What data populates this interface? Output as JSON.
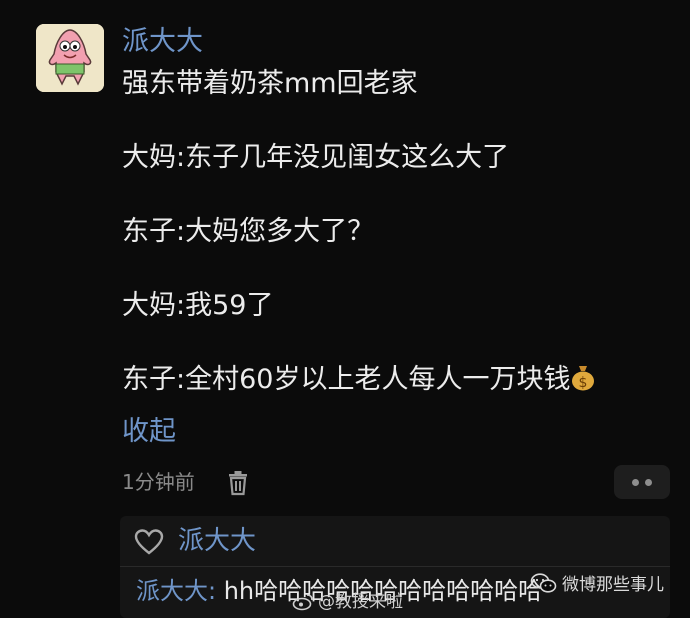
{
  "comment": {
    "author": "派大大",
    "lines": [
      "强东带着奶茶mm回老家",
      "大妈:东子几年没见闺女这么大了",
      "东子:大妈您多大了？",
      "大妈:我59了",
      "东子:全村60岁以上老人每人一万块钱"
    ],
    "collapse_label": "收起",
    "time": "1分钟前"
  },
  "likes_panel": {
    "liker_name": "派大大",
    "reply_author": "派大大:",
    "reply_text": " hh哈哈哈哈哈哈哈哈哈哈哈哈"
  },
  "watermarks": {
    "left": "@教授来啦",
    "right": "微博那些事儿"
  },
  "colors": {
    "background": "#0b0b0b",
    "username_blue": "#6f95c9",
    "text": "#ececec",
    "muted": "#8a8a8a"
  },
  "icons": [
    "avatar-patrick",
    "money-bag-emoji",
    "trash-icon",
    "more-icon",
    "heart-icon",
    "weibo-icon",
    "wechat-icon"
  ]
}
